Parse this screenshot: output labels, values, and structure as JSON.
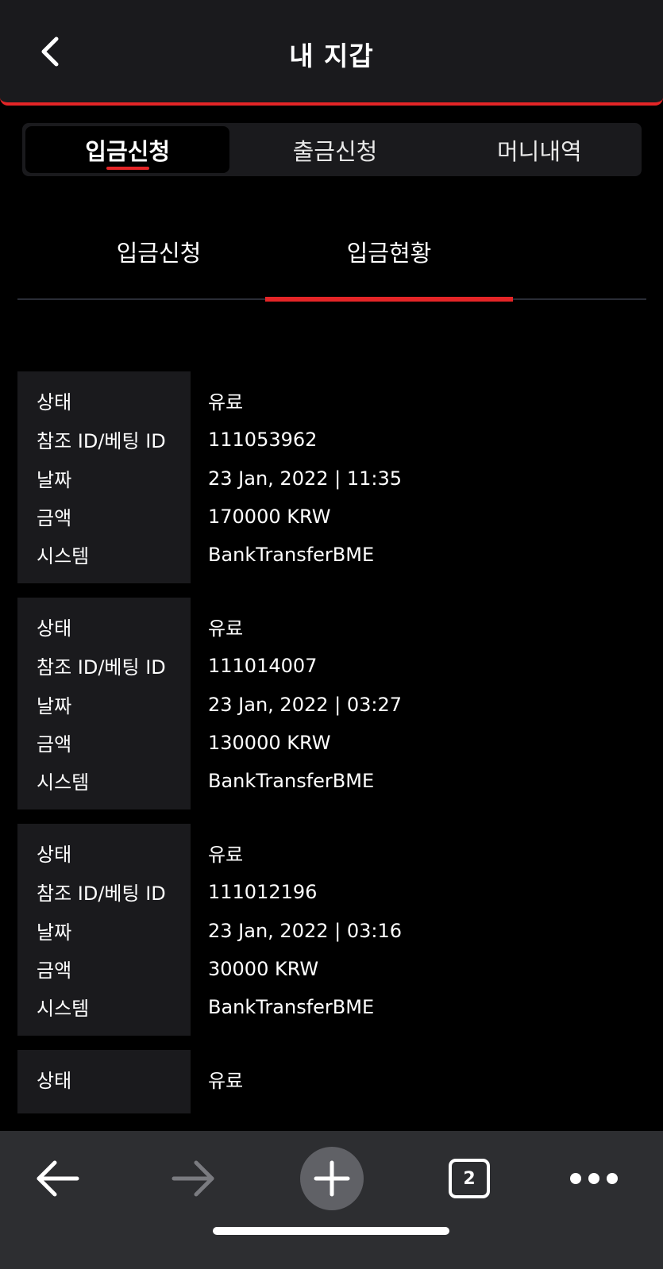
{
  "header": {
    "title": "내 지갑"
  },
  "main_tabs": [
    {
      "label": "입금신청",
      "active": true
    },
    {
      "label": "출금신청",
      "active": false
    },
    {
      "label": "머니내역",
      "active": false
    }
  ],
  "sub_tabs": [
    {
      "label": "입금신청",
      "active": false
    },
    {
      "label": "입금현황",
      "active": true
    }
  ],
  "field_labels": {
    "status": "상태",
    "ref_id": "참조 ID/베팅 ID",
    "date": "날짜",
    "amount": "금액",
    "system": "시스템"
  },
  "records": [
    {
      "status": "유료",
      "ref_id": "111053962",
      "date": "23 Jan, 2022 | 11:35",
      "amount": "170000 KRW",
      "system": "BankTransferBME"
    },
    {
      "status": "유료",
      "ref_id": "111014007",
      "date": "23 Jan, 2022 | 03:27",
      "amount": "130000 KRW",
      "system": "BankTransferBME"
    },
    {
      "status": "유료",
      "ref_id": "111012196",
      "date": "23 Jan, 2022 | 03:16",
      "amount": "30000 KRW",
      "system": "BankTransferBME"
    },
    {
      "status": "유료"
    }
  ],
  "browser_bar": {
    "tab_count": "2",
    "icons": [
      "back-arrow-icon",
      "forward-arrow-icon",
      "plus-icon",
      "tabs-icon",
      "more-icon"
    ]
  },
  "colors": {
    "accent": "#e42527",
    "panel": "#1a1a1d",
    "background": "#000000",
    "bottom_bar": "#2d2e31"
  }
}
